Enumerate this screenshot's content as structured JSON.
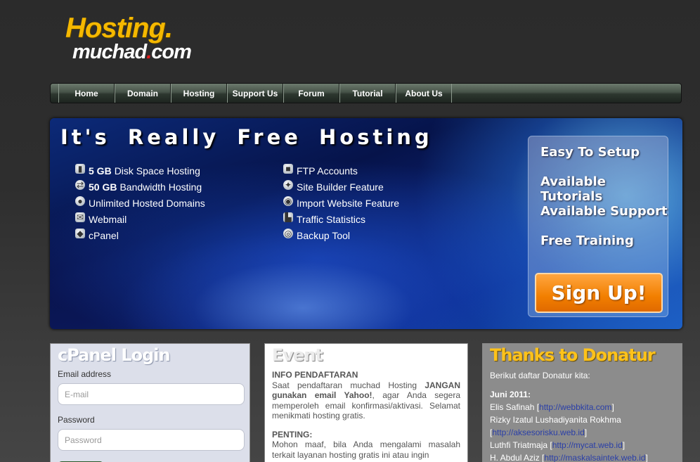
{
  "logo": {
    "line1": "Hosting.",
    "line2_a": "muchad",
    "line2_dot": ".",
    "line2_b": "com"
  },
  "nav": [
    {
      "label": "Home"
    },
    {
      "label": "Domain"
    },
    {
      "label": "Hosting"
    },
    {
      "label": "Support Us"
    },
    {
      "label": "Forum"
    },
    {
      "label": "Tutorial"
    },
    {
      "label": "About Us"
    }
  ],
  "banner": {
    "title": "It's Really Free Hosting",
    "features_left": [
      {
        "bold": "5 GB",
        "text": "Disk Space Hosting",
        "icon": "disk-icon"
      },
      {
        "bold": "50 GB",
        "text": "Bandwidth Hosting",
        "icon": "bandwidth-icon"
      },
      {
        "bold": "",
        "text": "Unlimited Hosted Domains",
        "icon": "globe-icon"
      },
      {
        "bold": "",
        "text": "Webmail",
        "icon": "mail-icon"
      },
      {
        "bold": "",
        "text": "cPanel",
        "icon": "cube-icon"
      }
    ],
    "features_right": [
      {
        "text": "FTP Accounts",
        "icon": "box-icon"
      },
      {
        "text": "Site Builder Feature",
        "icon": "builder-icon"
      },
      {
        "text": "Import Website Feature",
        "icon": "import-icon"
      },
      {
        "text": "Traffic Statistics",
        "icon": "chart-icon"
      },
      {
        "text": "Backup Tool",
        "icon": "backup-icon"
      }
    ],
    "perks": [
      "Easy To Setup",
      "Available Tutorials",
      "Available Support",
      "Free Training"
    ],
    "signup_label": "Sign Up!"
  },
  "cpanel": {
    "title": "cPanel Login",
    "email_label": "Email address",
    "email_placeholder": "E-mail",
    "password_label": "Password",
    "password_placeholder": "Password"
  },
  "event": {
    "title": "Event",
    "info_head": "INFO PENDAFTARAN",
    "info_text_1": "Saat pendaftaran muchad Hosting",
    "info_bold_1": "JANGAN gunakan email Yahoo!",
    "info_text_2": ", agar Anda segera memperoleh email konfirmasi/aktivasi. Selamat menikmati hosting gratis.",
    "penting_head": "PENTING:",
    "penting_text": "Mohon maaf, bila Anda mengalami masalah terkait layanan hosting gratis ini atau ingin"
  },
  "donatur": {
    "title": "Thanks to Donatur",
    "intro": "Berikut daftar Donatur kita:",
    "period": "Juni 2011:",
    "donors": [
      {
        "name": "Elis Safinah",
        "url": "http://webbkita.com"
      },
      {
        "name": "Rizky Izatul Lushadiyanita Rokhma",
        "url": "http://aksesorisku.web.id"
      },
      {
        "name": "Luthfi Triatmaja",
        "url": "http://mycat.web.id"
      },
      {
        "name": "H. Abdul Aziz",
        "url": "http://maskalsaintek.web.id"
      }
    ]
  }
}
